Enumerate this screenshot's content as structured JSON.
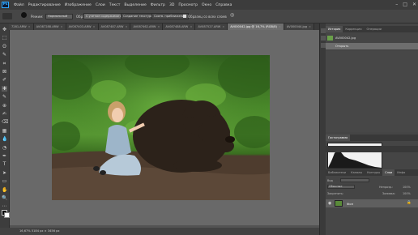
{
  "app": {
    "logo": "Ps",
    "colors": {
      "accent": "#31a8ff",
      "panel": "#454545",
      "canvas": "#696969"
    }
  },
  "menu": [
    "Файл",
    "Редактирование",
    "Изображение",
    "Слои",
    "Текст",
    "Выделение",
    "Фильтр",
    "3D",
    "Просмотр",
    "Окно",
    "Справка"
  ],
  "window_controls": [
    "–",
    "□",
    "✕"
  ],
  "options": {
    "mode_label": "Режим:",
    "mode_value": "Нормальный",
    "sample_label": "Обр:",
    "sample_value": "С учетом содержимого",
    "create_texture": "Создание текстуры",
    "proximity": "Соотв. приближению",
    "all_layers": "Образец со всех слоев"
  },
  "tabs": [
    {
      "label": "7281.ARW",
      "active": false
    },
    {
      "label": "AV087288.ARW",
      "active": false
    },
    {
      "label": "AV087403.ARW",
      "active": false
    },
    {
      "label": "AV087487.ARW",
      "active": false
    },
    {
      "label": "AV087462.ARW",
      "active": false
    },
    {
      "label": "AV087488.ARW",
      "active": false
    },
    {
      "label": "AV087527.ARW",
      "active": false
    },
    {
      "label": "AV000042.jpg @ 16,7% (RGB/8)",
      "active": true
    },
    {
      "label": "AV000044.jpg",
      "active": false
    }
  ],
  "tool_icons": [
    "move-icon",
    "marquee-icon",
    "lasso-icon",
    "quick-select-icon",
    "crop-icon",
    "frame-icon",
    "eyedropper-icon",
    "spot-heal-icon",
    "brush-icon",
    "stamp-icon",
    "history-brush-icon",
    "eraser-icon",
    "gradient-icon",
    "blur-icon",
    "dodge-icon",
    "pen-icon",
    "type-icon",
    "path-select-icon",
    "shape-icon",
    "hand-icon",
    "zoom-icon",
    "more-icon"
  ],
  "tool_glyphs": [
    "✥",
    "⬚",
    "ʘ",
    "✎",
    "⌗",
    "⊠",
    "✐",
    "✚",
    "✎",
    "⊕",
    "✍",
    "⌫",
    "▦",
    "💧",
    "◔",
    "✒",
    "T",
    "➤",
    "▭",
    "✋",
    "🔍",
    "⋯"
  ],
  "status": {
    "text": "16,67% 5184 px × 3456 px"
  },
  "history": {
    "tabs": [
      {
        "label": "История",
        "on": true
      },
      {
        "label": "Коррекция",
        "on": false
      },
      {
        "label": "Операции",
        "on": false
      }
    ],
    "snapshot": "AV000042.jpg",
    "step": "Открыть"
  },
  "histogram": {
    "tab": "Гистограмма"
  },
  "layers": {
    "tabs": [
      {
        "label": "Библиотеки",
        "on": false
      },
      {
        "label": "Каналы",
        "on": false
      },
      {
        "label": "Контуры",
        "on": false
      },
      {
        "label": "Слои",
        "on": true
      },
      {
        "label": "Инфо",
        "on": false
      }
    ],
    "kind_label": "Вид",
    "blend": "Обычные",
    "opacity_label": "Непрозр.:",
    "opacity_value": "100%",
    "lock_label": "Закрепить:",
    "fill_label": "Заливка:",
    "fill_value": "100%",
    "layer_name": "Фон"
  }
}
